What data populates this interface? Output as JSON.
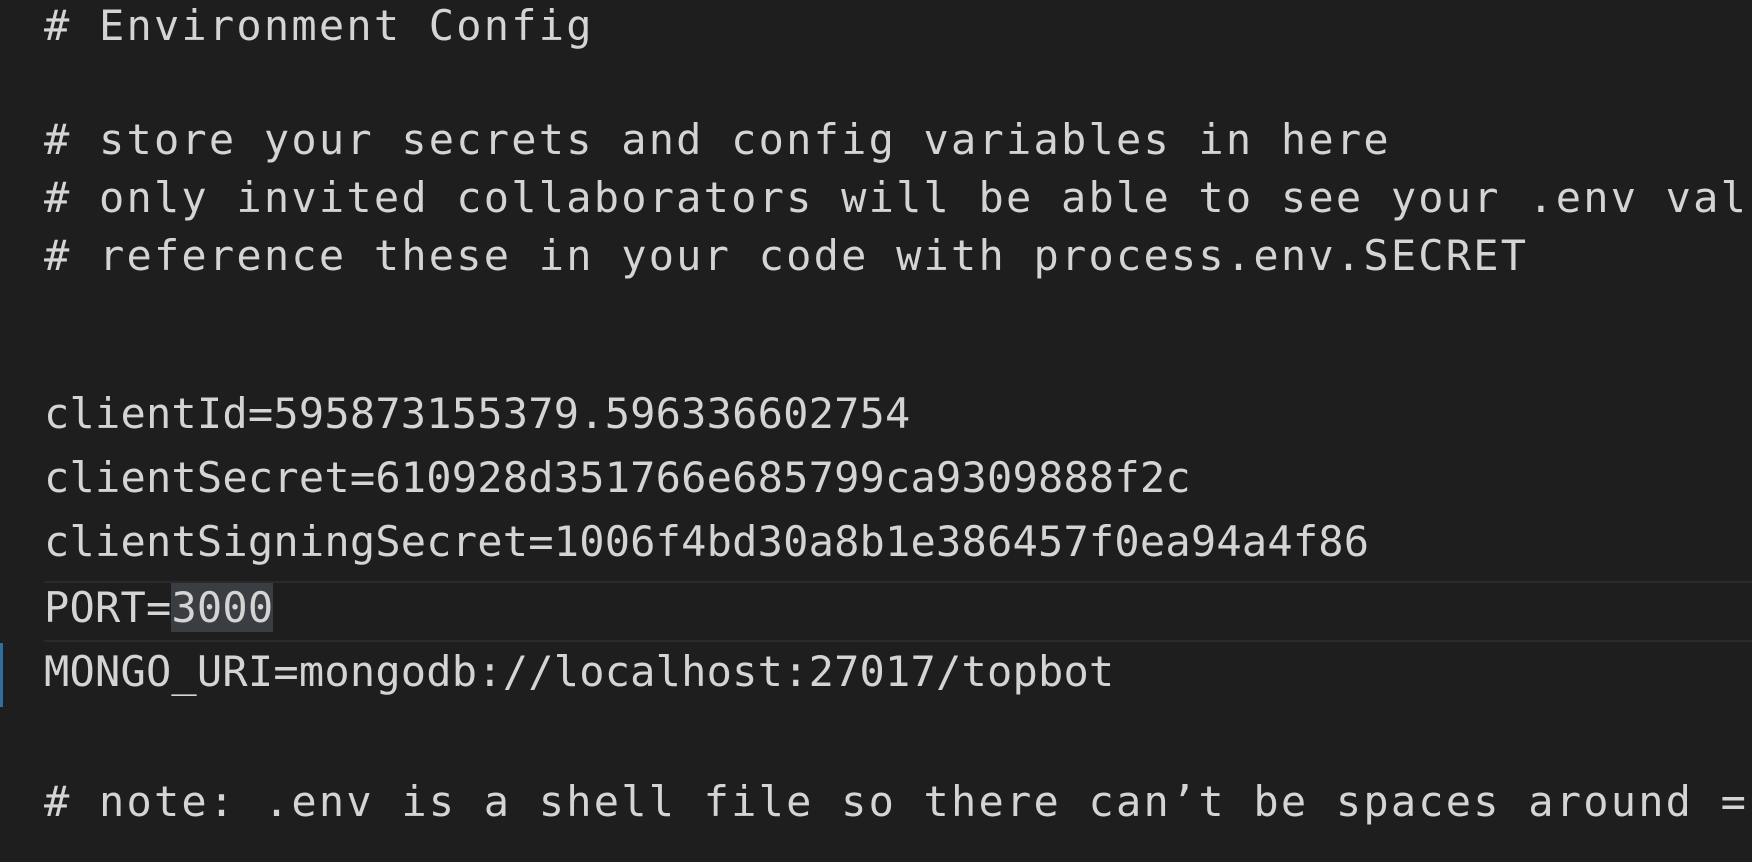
{
  "editor": {
    "lines": {
      "l1": "# Environment Config",
      "l3": "# store your secrets and config variables in here",
      "l4": "# only invited collaborators will be able to see your .env values",
      "l5": "# reference these in your code with process.env.SECRET",
      "l7": "clientId=595873155379.596336602754",
      "l8": "clientSecret=610928d351766e685799ca9309888f2c",
      "l9": "clientSigningSecret=1006f4bd30a8b1e386457f0ea94a4f86",
      "l10_key": "PORT=",
      "l10_value": "3000",
      "l11": "MONGO_URI=mongodb://localhost:27017/topbot",
      "l13": "# note: .env is a shell file so there can’t be spaces around ="
    }
  }
}
